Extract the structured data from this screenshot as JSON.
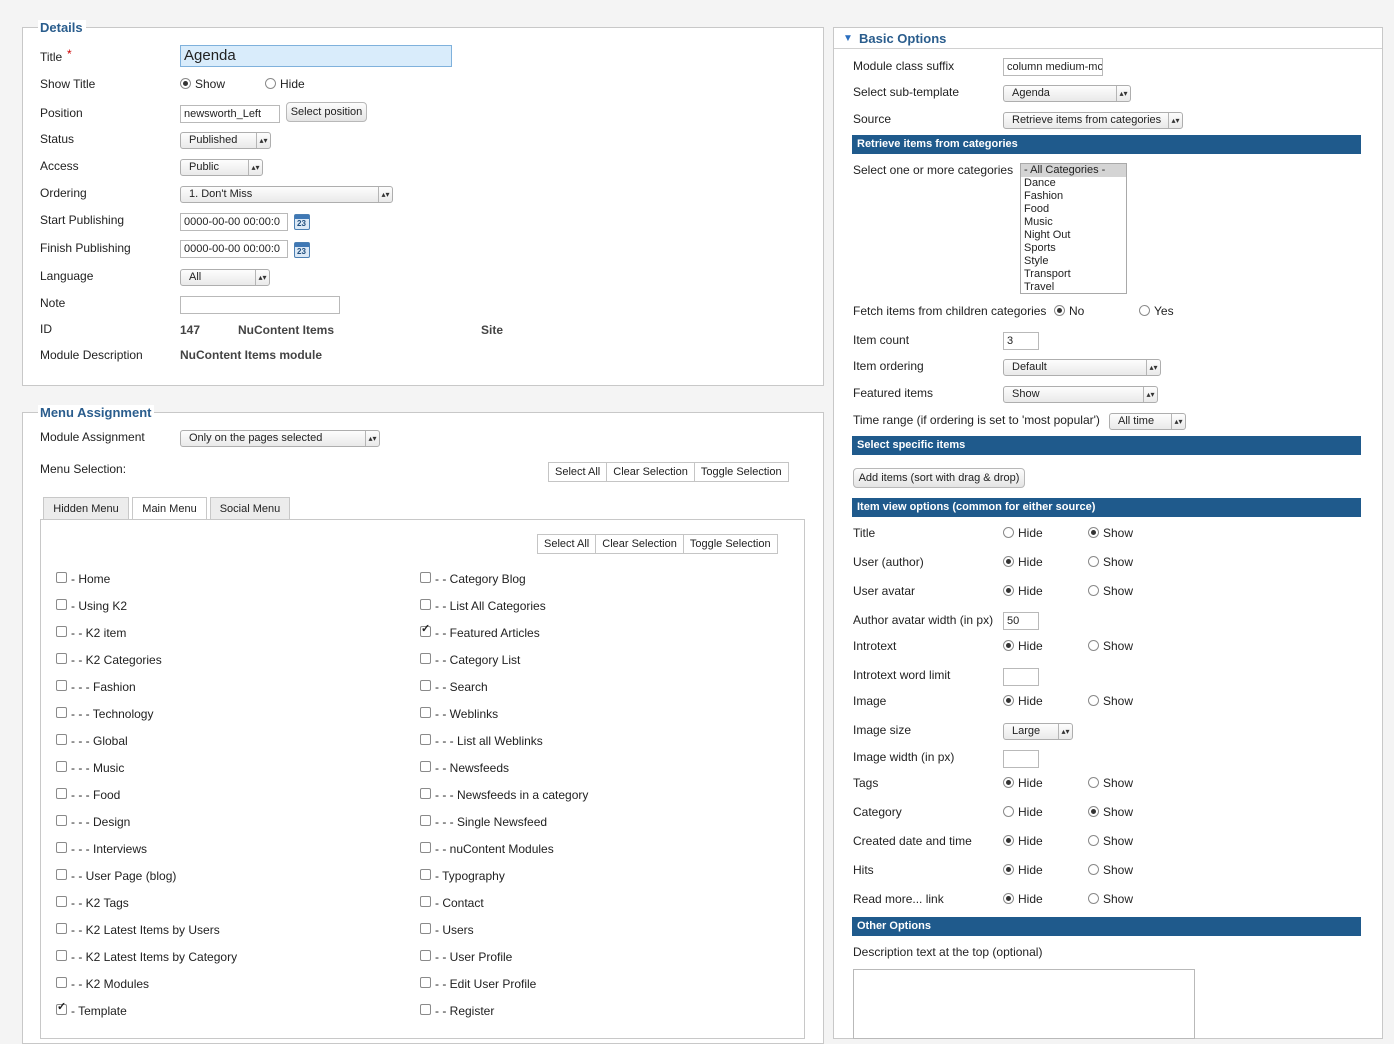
{
  "details": {
    "legend": "Details",
    "title_label": "Title",
    "title_required": "*",
    "title_value": "Agenda",
    "show_title_label": "Show Title",
    "show_title_show": "Show",
    "show_title_hide": "Hide",
    "position_label": "Position",
    "position_value": "newsworth_Left",
    "select_position_button": "Select position",
    "status_label": "Status",
    "status_value": "Published",
    "access_label": "Access",
    "access_value": "Public",
    "ordering_label": "Ordering",
    "ordering_value": "1. Don't Miss",
    "start_publishing_label": "Start Publishing",
    "start_publishing_value": "0000-00-00 00:00:0",
    "finish_publishing_label": "Finish Publishing",
    "finish_publishing_value": "0000-00-00 00:00:0",
    "calendar_day": "23",
    "language_label": "Language",
    "language_value": "All",
    "note_label": "Note",
    "note_value": "",
    "id_label": "ID",
    "id_value": "147",
    "module_type": "NuContent Items",
    "client": "Site",
    "module_description_label": "Module Description",
    "module_description_value": "NuContent Items module"
  },
  "menu_assignment": {
    "legend": "Menu Assignment",
    "module_assignment_label": "Module Assignment",
    "module_assignment_value": "Only on the pages selected",
    "menu_selection_label": "Menu Selection:",
    "select_all": "Select All",
    "clear_selection": "Clear Selection",
    "toggle_selection": "Toggle Selection",
    "tabs": [
      "Hidden Menu",
      "Main Menu",
      "Social Menu"
    ],
    "items_left": [
      {
        "label": "- Home",
        "checked": false
      },
      {
        "label": "- Using K2",
        "checked": false
      },
      {
        "label": "- - K2 item",
        "checked": false
      },
      {
        "label": "- - K2 Categories",
        "checked": false
      },
      {
        "label": "- - - Fashion",
        "checked": false
      },
      {
        "label": "- - - Technology",
        "checked": false
      },
      {
        "label": "- - - Global",
        "checked": false
      },
      {
        "label": "- - - Music",
        "checked": false
      },
      {
        "label": "- - - Food",
        "checked": false
      },
      {
        "label": "- - - Design",
        "checked": false
      },
      {
        "label": "- - - Interviews",
        "checked": false
      },
      {
        "label": "- - User Page (blog)",
        "checked": false
      },
      {
        "label": "- - K2 Tags",
        "checked": false
      },
      {
        "label": "- - K2 Latest Items by Users",
        "checked": false
      },
      {
        "label": "- - K2 Latest Items by Category",
        "checked": false
      },
      {
        "label": "- - K2 Modules",
        "checked": false
      },
      {
        "label": "- Template",
        "checked": true
      }
    ],
    "items_right": [
      {
        "label": "- - Category Blog",
        "checked": false
      },
      {
        "label": "- - List All Categories",
        "checked": false
      },
      {
        "label": "- - Featured Articles",
        "checked": true
      },
      {
        "label": "- - Category List",
        "checked": false
      },
      {
        "label": "- - Search",
        "checked": false
      },
      {
        "label": "- - Weblinks",
        "checked": false
      },
      {
        "label": "- - - List all Weblinks",
        "checked": false
      },
      {
        "label": "- - Newsfeeds",
        "checked": false
      },
      {
        "label": "- - - Newsfeeds in a category",
        "checked": false
      },
      {
        "label": "- - - Single Newsfeed",
        "checked": false
      },
      {
        "label": "- - nuContent Modules",
        "checked": false
      },
      {
        "label": "- Typography",
        "checked": false
      },
      {
        "label": "- Contact",
        "checked": false
      },
      {
        "label": "- Users",
        "checked": false
      },
      {
        "label": "- - User Profile",
        "checked": false
      },
      {
        "label": "- - Edit User Profile",
        "checked": false
      },
      {
        "label": "- - Register",
        "checked": false
      }
    ]
  },
  "basic_options": {
    "header": "Basic Options",
    "module_class_suffix_label": "Module class suffix",
    "module_class_suffix_value": "column medium-mc",
    "sub_template_label": "Select sub-template",
    "sub_template_value": "Agenda",
    "source_label": "Source",
    "source_value": "Retrieve items from categories",
    "section_categories": "Retrieve items from categories",
    "categories_label": "Select one or more categories",
    "categories": [
      "- All Categories -",
      "Dance",
      "Fashion",
      "Food",
      "Music",
      "Night Out",
      "Sports",
      "Style",
      "Transport",
      "Travel"
    ],
    "fetch_children_label": "Fetch items from children categories",
    "no": "No",
    "yes": "Yes",
    "item_count_label": "Item count",
    "item_count_value": "3",
    "item_ordering_label": "Item ordering",
    "item_ordering_value": "Default",
    "featured_items_label": "Featured items",
    "featured_items_value": "Show",
    "time_range_label": "Time range (if ordering is set to 'most popular')",
    "time_range_value": "All time",
    "section_specific": "Select specific items",
    "add_items_button": "Add items (sort with drag & drop)",
    "section_item_view": "Item view options (common for either source)",
    "hide": "Hide",
    "show": "Show",
    "view_options": [
      {
        "label": "Title",
        "value": "show"
      },
      {
        "label": "User (author)",
        "value": "hide"
      },
      {
        "label": "User avatar",
        "value": "hide"
      }
    ],
    "author_avatar_width_label": "Author avatar width (in px)",
    "author_avatar_width_value": "50",
    "introtext_label": "Introtext",
    "introtext_value": "hide",
    "introtext_limit_label": "Introtext word limit",
    "introtext_limit_value": "",
    "image_label": "Image",
    "image_value": "hide",
    "image_size_label": "Image size",
    "image_size_value": "Large",
    "image_width_label": "Image width (in px)",
    "image_width_value": "",
    "view_options_2": [
      {
        "label": "Tags",
        "value": "hide"
      },
      {
        "label": "Category",
        "value": "show"
      },
      {
        "label": "Created date and time",
        "value": "hide"
      },
      {
        "label": "Hits",
        "value": "hide"
      },
      {
        "label": "Read more... link",
        "value": "hide"
      }
    ],
    "section_other": "Other Options",
    "description_top_label": "Description text at the top (optional)"
  }
}
